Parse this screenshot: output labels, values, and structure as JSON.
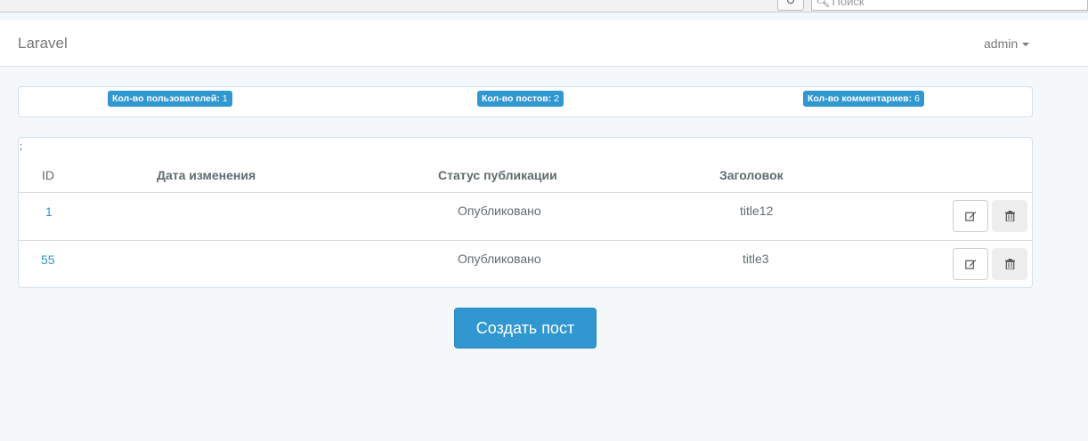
{
  "browser": {
    "reload_icon": "reload-icon",
    "search_placeholder": "Поиск"
  },
  "navbar": {
    "brand": "Laravel",
    "user": "admin"
  },
  "stats": {
    "users_label": "Кол-во пользователей:",
    "users_count": "1",
    "posts_label": "Кол-во постов:",
    "posts_count": "2",
    "comments_label": "Кол-во комментариев:",
    "comments_count": "6"
  },
  "table": {
    "corner_mark": ";",
    "headers": [
      "ID",
      "Дата изменения",
      "Статус публикации",
      "Заголовок"
    ],
    "rows": [
      {
        "id": "1",
        "date": "",
        "status": "Опубликовано",
        "title": "title12"
      },
      {
        "id": "55",
        "date": "",
        "status": "Опубликовано",
        "title": "title3"
      }
    ]
  },
  "actions": {
    "create_post": "Создать пост"
  },
  "colors": {
    "accent": "#3097d1",
    "background": "#f5f8fa"
  }
}
